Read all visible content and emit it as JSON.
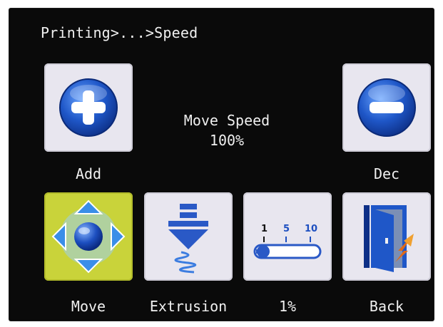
{
  "header": {
    "breadcrumb": "Printing>...>Speed"
  },
  "speed": {
    "title": "Move Speed",
    "value": "100%"
  },
  "buttons": {
    "add": "Add",
    "dec": "Dec",
    "move": "Move",
    "extrusion": "Extrusion",
    "step": "1%",
    "back": "Back"
  },
  "step_scale": {
    "ticks": [
      "1",
      "5",
      "10"
    ],
    "selected": "1"
  },
  "icons": {
    "add": "plus-circle-icon",
    "dec": "minus-circle-icon",
    "move": "move-dpad-icon",
    "extrusion": "extruder-arrow-spring-icon",
    "step": "step-slider-icon",
    "back": "exit-door-icon"
  },
  "colors": {
    "tile": "#e8e6ef",
    "tile_active": "#c9d33a",
    "icon_blue": "#1f57c8",
    "background": "#0a0a0a",
    "text": "#f0f0f0"
  }
}
